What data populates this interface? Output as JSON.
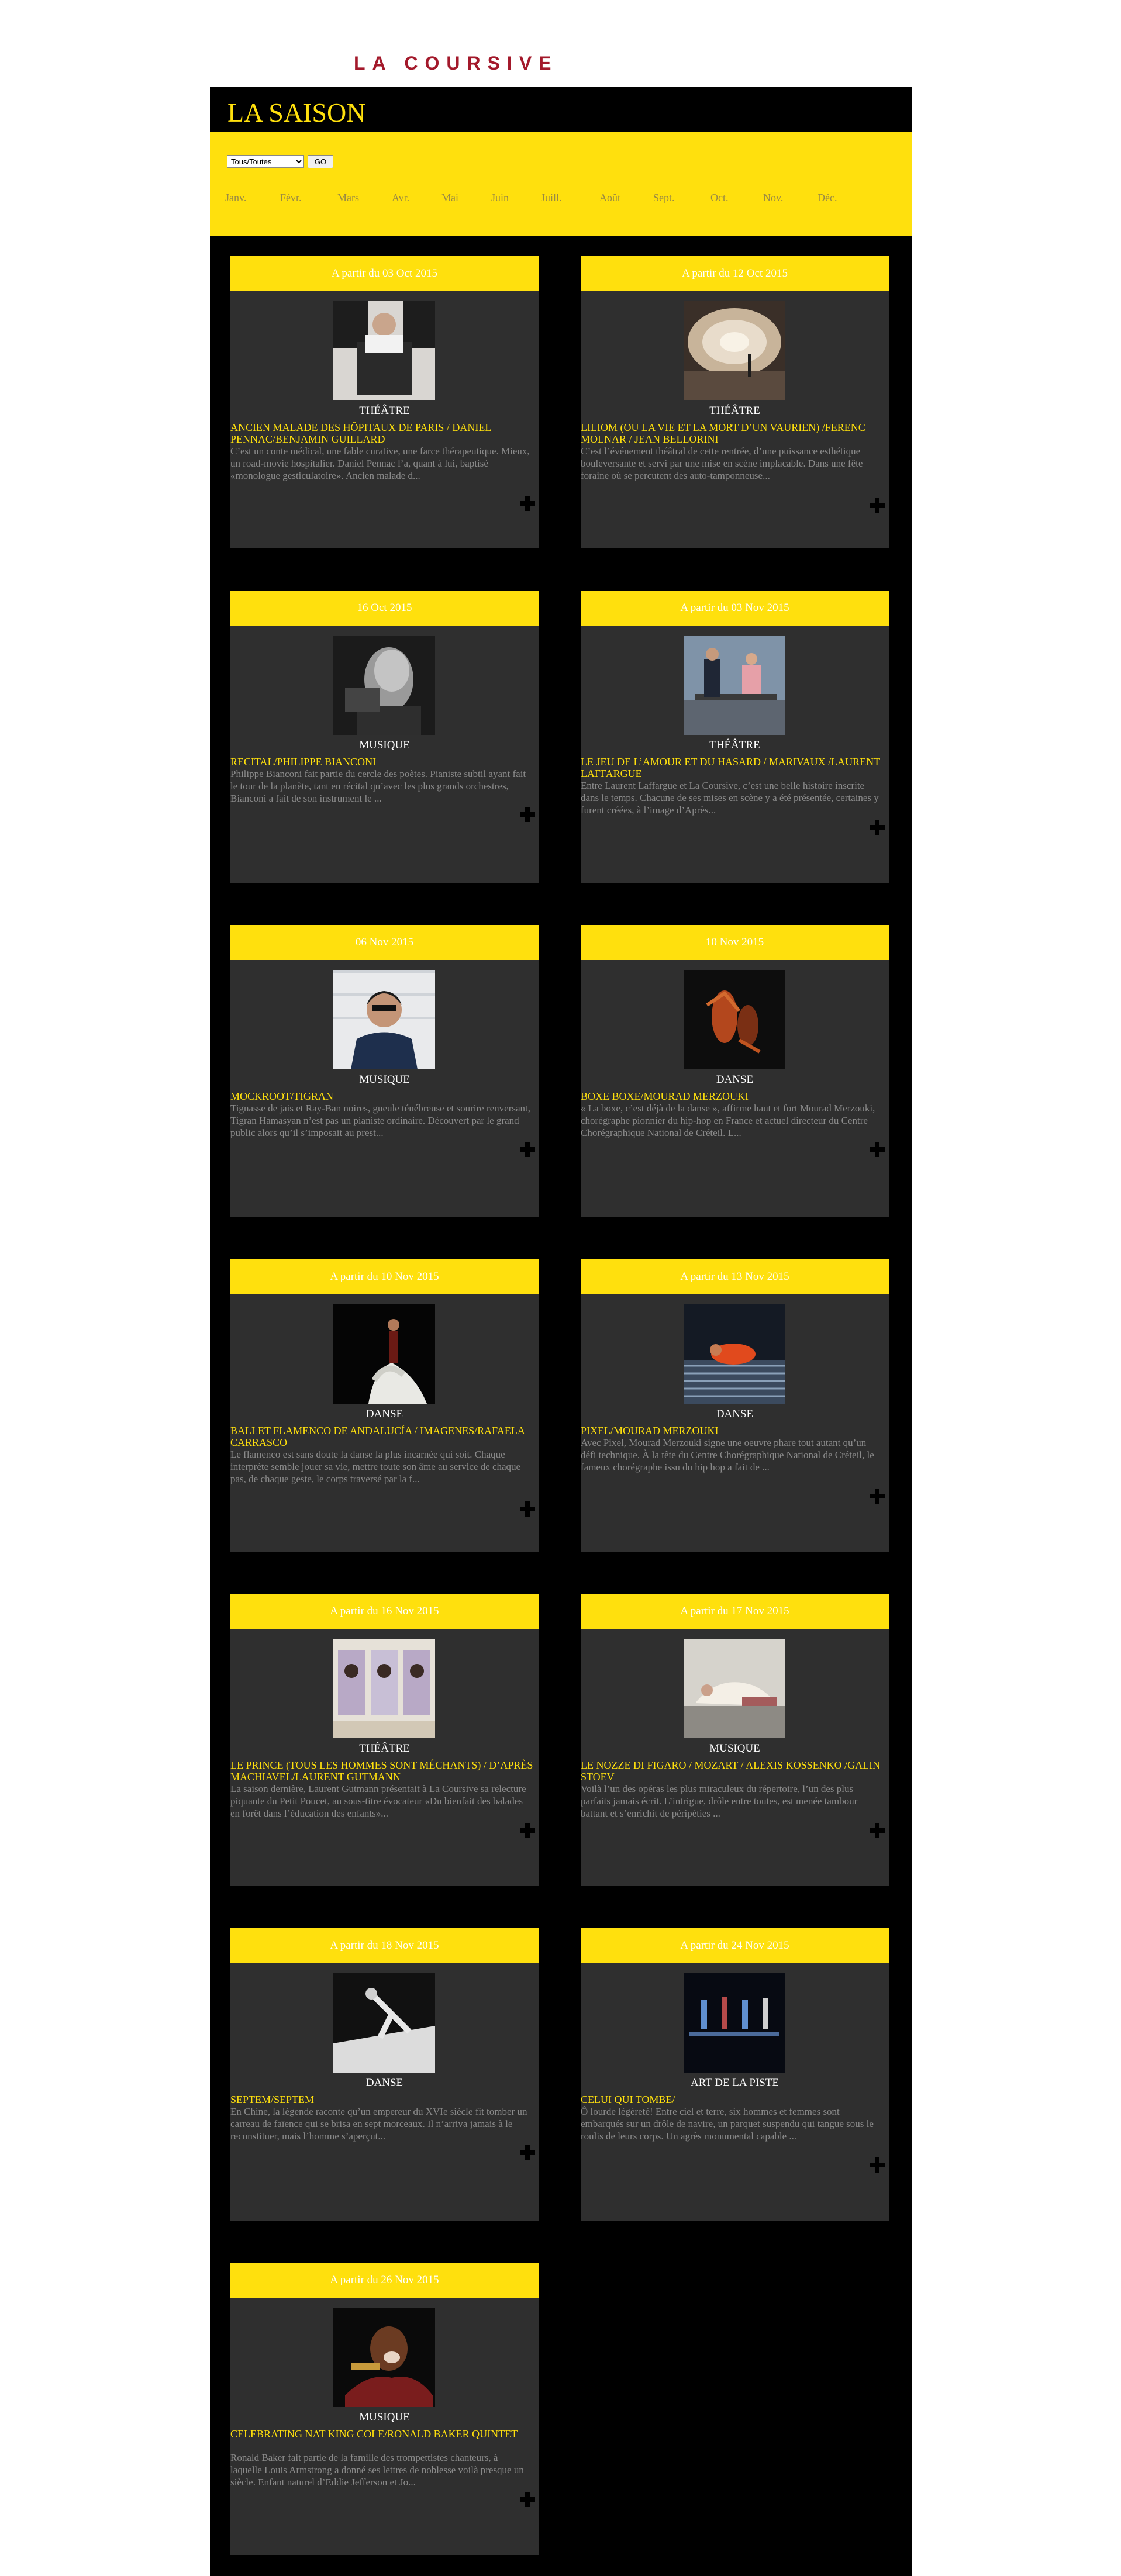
{
  "header": {
    "logo": "LA COURSIVE",
    "page_title": "LA SAISON"
  },
  "filter": {
    "selected": "Tous/Toutes",
    "go_label": "GO"
  },
  "months": [
    "Janv.",
    "Févr.",
    "Mars",
    "Avr.",
    "Mai",
    "Juin",
    "Juill.",
    "Août",
    "Sept.",
    "Oct.",
    "Nov.",
    "Déc."
  ],
  "colors": {
    "accent": "#ffe00d",
    "background": "#000000",
    "card": "#2f2f2f",
    "logo": "#a3192b"
  },
  "events": [
    {
      "date": "A partir du 03 Oct 2015",
      "category": "THÉÂTRE",
      "title": "ANCIEN MALADE DES HÔPITAUX DE PARIS / DANIEL PENNAC/BENJAMIN GUILLARD",
      "description": "C’est un conte médical, une fable curative, une farce thérapeutique. Mieux, un road-movie hospitalier. Daniel Pennac l’a, quant à lui, baptisé «monologue gesticulatoire». Ancien malade d...",
      "image": "man-with-laptop-photo"
    },
    {
      "date": "A partir du 12 Oct 2015",
      "category": "THÉÂTRE",
      "title": "LILIOM (OU LA VIE ET LA MORT D’UN VAURIEN) /FERENC MOLNAR / JEAN BELLORINI",
      "description": "C’est l’événement théâtral de cette rentrée, d’une puissance esthétique bouleversante et servi par une mise en scène implacable. Dans une fête foraine où se percutent des auto-tamponneuse...",
      "image": "carousel-stage-photo"
    },
    {
      "date": "16 Oct 2015",
      "category": "MUSIQUE",
      "title": "RECITAL/PHILIPPE BIANCONI",
      "description": "Philippe Bianconi fait partie du cercle des poètes. Pianiste subtil ayant fait le tour de la planète, tant en récital qu’avec les plus grands orchestres, Bianconi a fait de son instrument le ...",
      "image": "pianist-portrait-photo"
    },
    {
      "date": "A partir du 03 Nov 2015",
      "category": "THÉÂTRE",
      "title": "LE JEU DE L’AMOUR ET DU HASARD / MARIVAUX /LAURENT LAFFARGUE",
      "description": "Entre Laurent Laffargue et La Coursive, c’est une belle histoire inscrite dans le temps. Chacune de ses mises en scène y a été présentée, certaines y furent créées, à l’image d’Après...",
      "image": "actors-on-bench-photo"
    },
    {
      "date": "06 Nov 2015",
      "category": "MUSIQUE",
      "title": "MOCKROOT/TIGRAN",
      "description": "Tignasse de jais et Ray-Ban noires, gueule ténébreuse et sourire renversant, Tigran Hamasyan n’est pas un pianiste ordinaire. Découvert par le grand public alors qu’il s’imposait au prest...",
      "image": "musician-sunglasses-photo"
    },
    {
      "date": "10 Nov 2015",
      "category": "DANSE",
      "title": "BOXE BOXE/MOURAD MERZOUKI",
      "description": "« La boxe, c’est déjà de la danse », affirme haut et fort Mourad Merzouki, chorégraphe pionnier du hip-hop en France et actuel directeur du Centre Chorégraphique National de Créteil. L...",
      "image": "boxing-dancers-photo"
    },
    {
      "date": "A partir du 10 Nov 2015",
      "category": "DANSE",
      "title": "BALLET FLAMENCO DE ANDALUCÍA / IMAGENES/RAFAELA CARRASCO",
      "description": "Le flamenco est sans doute la danse la plus incarnée qui soit. Chaque interprète semble jouer sa vie, mettre toute son âme au service de chaque pas, de chaque geste, le corps traversé par la f...",
      "image": "flamenco-dancer-photo"
    },
    {
      "date": "A partir du 13 Nov 2015",
      "category": "DANSE",
      "title": "PIXEL/MOURAD MERZOUKI",
      "description": "Avec Pixel, Mourad Merzouki signe une oeuvre phare tout autant qu’un défi technique. À la tête du Centre Chorégraphique National de Créteil, le fameux chorégraphe issu du hip hop a fait de ...",
      "image": "pixel-dancer-photo"
    },
    {
      "date": "A partir du 16 Nov 2015",
      "category": "THÉÂTRE",
      "title": "LE PRINCE (TOUS LES HOMMES SONT MÉCHANTS) / D’APRÈS MACHIAVEL/LAURENT GUTMANN",
      "description": "La saison dernière, Laurent Gutmann présentait à La Coursive sa relecture piquante du Petit Poucet, au sous-titre évocateur «Du bienfait des balades en forêt dans l’éducation des enfants»...",
      "image": "portraits-triptych-photo"
    },
    {
      "date": "A partir du 17 Nov 2015",
      "category": "MUSIQUE",
      "title": "LE NOZZE DI FIGARO / MOZART / ALEXIS KOSSENKO /GALIN STOEV",
      "description": "Voilà l’un des opéras les plus miraculeux du répertoire, l’un des plus parfaits jamais écrit. L’intrigue, drôle entre toutes, est menée tambour battant et s’enrichit de péripéties ...",
      "image": "reclining-woman-photo"
    },
    {
      "date": "A partir du 18 Nov 2015",
      "category": "DANSE",
      "title": "SEPTEM/SEPTEM",
      "description": "En Chine, la légende raconte qu’un empereur du XVIe siècle fit tomber un carreau de faïence qui se brisa en sept morceaux. Il n’arriva jamais à le reconstituer, mais l’homme s’aperçut...",
      "image": "bw-dancer-photo"
    },
    {
      "date": "A partir du 24 Nov 2015",
      "category": "ART DE LA PISTE",
      "title": "CELUI QUI TOMBE/",
      "description": "Ô lourde légèreté! Entre ciel et terre, six hommes et femmes sont embarqués sur un drôle de navire, un parquet suspendu qui tangue sous le roulis de leurs corps. Un agrès monumental capable ...",
      "image": "suspended-stage-photo"
    },
    {
      "date": "A partir du 26 Nov 2015",
      "category": "MUSIQUE",
      "title": "CELEBRATING NAT KING COLE/RONALD BAKER QUINTET",
      "description": "Ronald Baker fait partie de la famille des trompettistes chanteurs, à laquelle Louis Armstrong a donné ses lettres de noblesse voilà presque un siècle. Enfant naturel d’Eddie Jefferson et Jo...",
      "image": "trumpet-singer-photo"
    }
  ]
}
